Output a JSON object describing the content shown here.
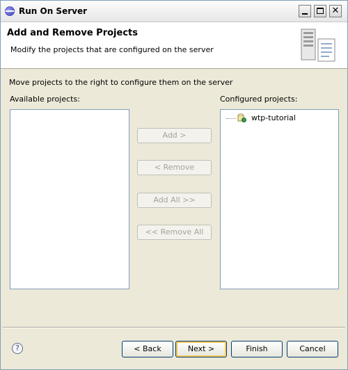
{
  "window": {
    "title": "Run On Server"
  },
  "banner": {
    "title": "Add and Remove Projects",
    "description": "Modify the projects that are configured on the server"
  },
  "instructions": "Move projects to the right to configure them on the server",
  "available": {
    "label": "Available projects:",
    "items": []
  },
  "configured": {
    "label": "Configured projects:",
    "items": [
      "wtp-tutorial"
    ]
  },
  "actions": {
    "add": "Add >",
    "remove": "< Remove",
    "add_all": "Add All >>",
    "remove_all": "<< Remove All"
  },
  "footer": {
    "help": "?",
    "back": "< Back",
    "next": "Next >",
    "finish": "Finish",
    "cancel": "Cancel"
  },
  "colors": {
    "disabled_text": "#a5a39a",
    "dialog_bg": "#ece9d8",
    "default_button_ring": "#f6c95a"
  }
}
